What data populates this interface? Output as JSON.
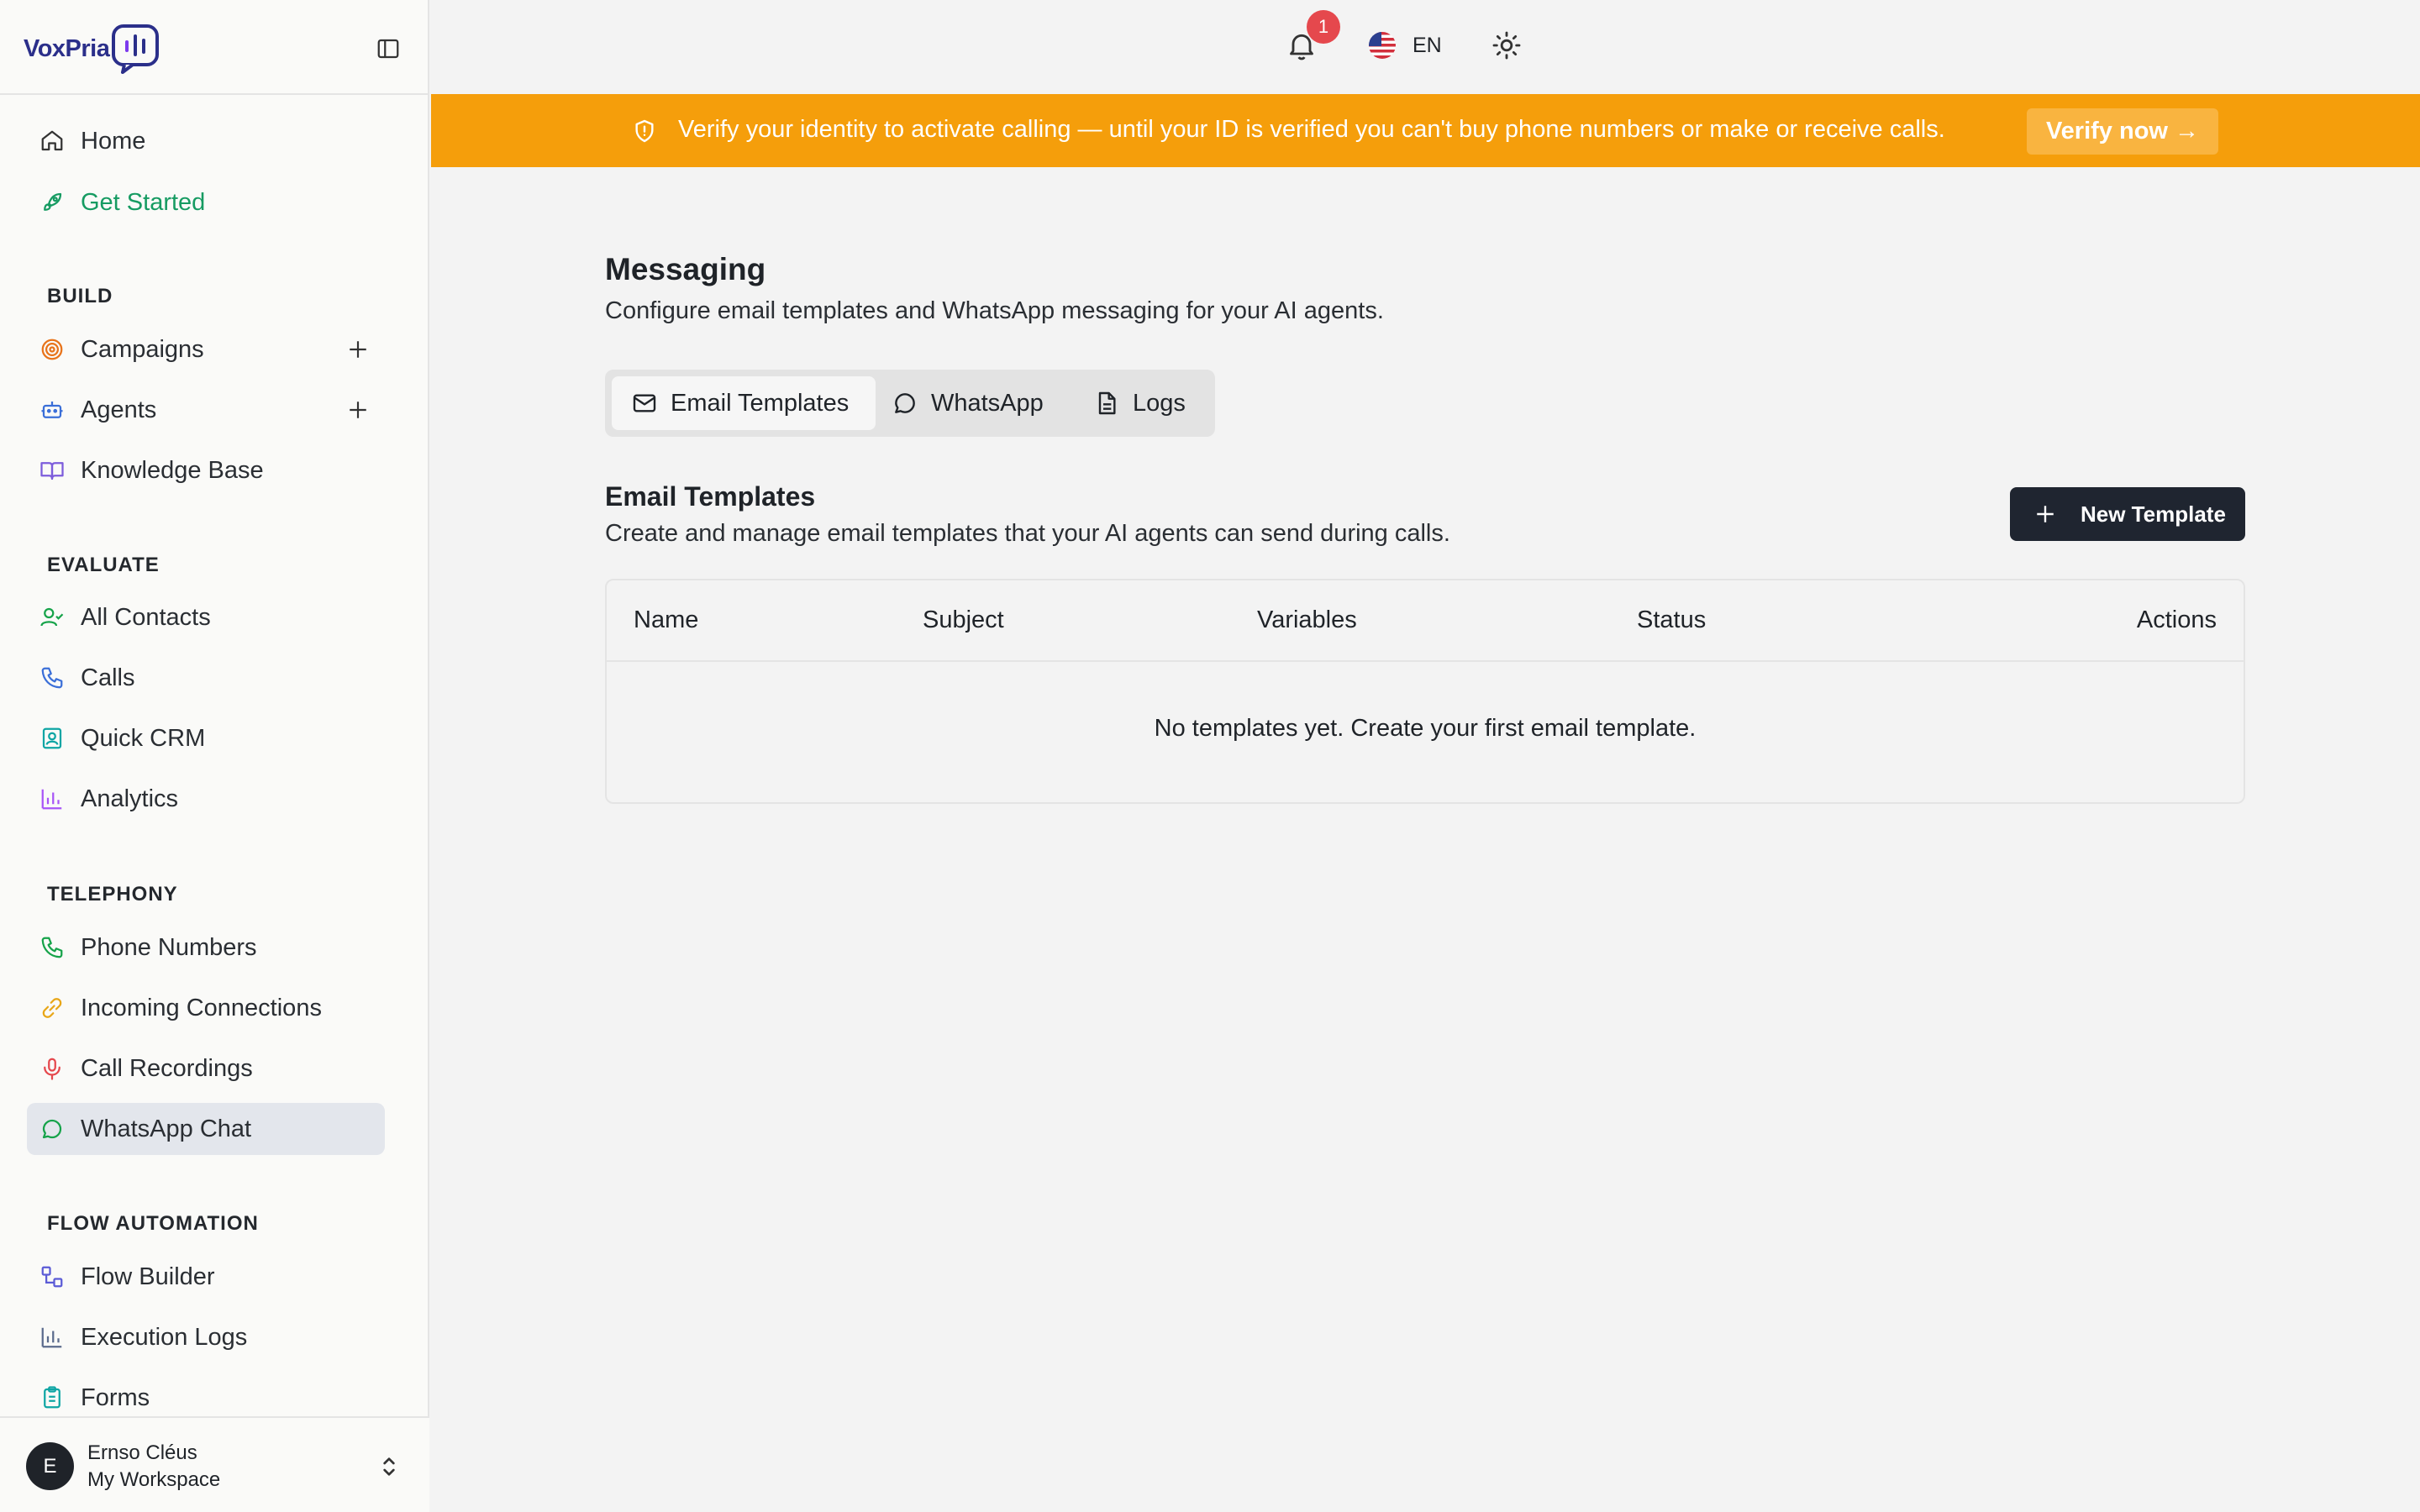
{
  "app": {
    "logo_text": "VoxPria",
    "brand_color": "#2b2f8a"
  },
  "sidebar": {
    "top_items": [
      {
        "label": "Home",
        "icon": "home-icon"
      },
      {
        "label": "Get Started",
        "icon": "rocket-icon",
        "color": "#169b62"
      }
    ],
    "sections": [
      {
        "title": "BUILD",
        "items": [
          {
            "label": "Campaigns",
            "icon": "target-icon",
            "has_add": true
          },
          {
            "label": "Agents",
            "icon": "bot-icon",
            "has_add": true
          },
          {
            "label": "Knowledge Base",
            "icon": "book-icon"
          }
        ]
      },
      {
        "title": "EVALUATE",
        "items": [
          {
            "label": "All Contacts",
            "icon": "user-check-icon"
          },
          {
            "label": "Calls",
            "icon": "phone-icon"
          },
          {
            "label": "Quick CRM",
            "icon": "contact-card-icon"
          },
          {
            "label": "Analytics",
            "icon": "bar-chart-icon"
          }
        ]
      },
      {
        "title": "TELEPHONY",
        "items": [
          {
            "label": "Phone Numbers",
            "icon": "phone-icon"
          },
          {
            "label": "Incoming Connections",
            "icon": "link-icon"
          },
          {
            "label": "Call Recordings",
            "icon": "mic-icon"
          },
          {
            "label": "WhatsApp Chat",
            "icon": "message-circle-icon",
            "active": true
          }
        ]
      },
      {
        "title": "FLOW AUTOMATION",
        "items": [
          {
            "label": "Flow Builder",
            "icon": "workflow-icon"
          },
          {
            "label": "Execution Logs",
            "icon": "bar-chart-icon"
          },
          {
            "label": "Forms",
            "icon": "clipboard-icon"
          }
        ]
      }
    ],
    "user": {
      "initial": "E",
      "name": "Ernso Cléus",
      "workspace": "My Workspace"
    }
  },
  "topbar": {
    "notification_count": "1",
    "language": "EN"
  },
  "banner": {
    "text": "Verify your identity to activate calling — until your ID is verified you can't buy phone numbers or make or receive calls.",
    "button_label": "Verify now →",
    "color": "#f59e0b"
  },
  "main": {
    "title": "Messaging",
    "subtitle": "Configure email templates and WhatsApp messaging for your AI agents.",
    "tabs": [
      {
        "label": "Email Templates",
        "icon": "mail-icon",
        "active": true
      },
      {
        "label": "WhatsApp",
        "icon": "message-circle-icon"
      },
      {
        "label": "Logs",
        "icon": "file-text-icon"
      }
    ],
    "section": {
      "title": "Email Templates",
      "description": "Create and manage email templates that your AI agents can send during calls.",
      "new_button_label": "New Template"
    },
    "table": {
      "columns": [
        "Name",
        "Subject",
        "Variables",
        "Status",
        "Actions"
      ],
      "empty_text": "No templates yet. Create your first email template."
    }
  }
}
